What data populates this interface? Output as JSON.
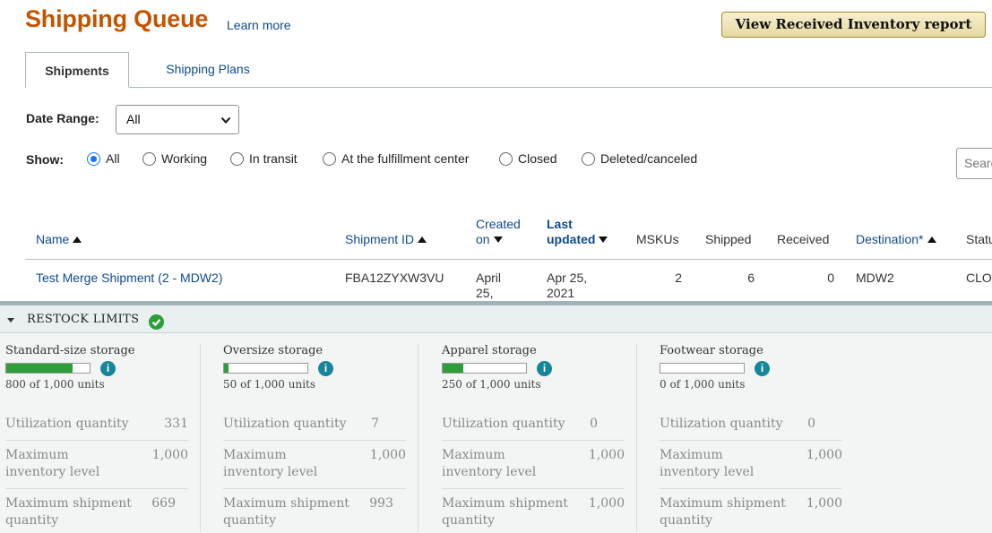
{
  "header": {
    "title": "Shipping Queue",
    "learn_more": "Learn more",
    "report_button": "View Received Inventory report"
  },
  "tabs": [
    {
      "label": "Shipments",
      "active": true
    },
    {
      "label": "Shipping Plans",
      "active": false
    }
  ],
  "filters": {
    "date_range_label": "Date Range:",
    "date_range_value": "All",
    "show_label": "Show:",
    "show_options": [
      {
        "label": "All",
        "checked": true
      },
      {
        "label": "Working",
        "checked": false
      },
      {
        "label": "In transit",
        "checked": false
      },
      {
        "label": "At the fulfillment center",
        "checked": false
      },
      {
        "label": "Closed",
        "checked": false
      },
      {
        "label": "Deleted/canceled",
        "checked": false
      }
    ],
    "search_placeholder": "Search"
  },
  "table": {
    "columns": {
      "name": "Name",
      "shipment_id": "Shipment ID",
      "created_on_1": "Created",
      "created_on_2": "on",
      "last_updated_1": "Last",
      "last_updated_2": "updated",
      "mskus": "MSKUs",
      "shipped": "Shipped",
      "received": "Received",
      "destination": "Destination*",
      "status": "Status"
    },
    "rows": [
      {
        "name": "Test Merge Shipment (2 - MDW2)",
        "shipment_id": "FBA12ZYXW3VU",
        "created_on_1": "April",
        "created_on_2": "25,",
        "last_updated_1": "Apr 25,",
        "last_updated_2": "2021",
        "mskus": "2",
        "shipped": "6",
        "received": "0",
        "destination": "MDW2",
        "status": "CLOSED"
      }
    ]
  },
  "restock": {
    "title": "RESTOCK LIMITS",
    "status_color": "#2e9e3a",
    "categories": [
      {
        "name": "Standard-size storage",
        "fill": 0.8,
        "units": "800 of 1,000 units",
        "metrics": [
          {
            "label": "Utilization quantity",
            "value": "331"
          },
          {
            "label": "Maximum inventory level",
            "value": "1,000"
          },
          {
            "label": "Maximum shipment quantity",
            "value": "669"
          }
        ]
      },
      {
        "name": "Oversize storage",
        "fill": 0.05,
        "units": "50 of 1,000 units",
        "metrics": [
          {
            "label": "Utilization quantity",
            "value": "7"
          },
          {
            "label": "Maximum inventory level",
            "value": "1,000"
          },
          {
            "label": "Maximum shipment quantity",
            "value": "993"
          }
        ]
      },
      {
        "name": "Apparel storage",
        "fill": 0.25,
        "units": "250 of 1,000 units",
        "metrics": [
          {
            "label": "Utilization quantity",
            "value": "0"
          },
          {
            "label": "Maximum inventory level",
            "value": "1,000"
          },
          {
            "label": "Maximum shipment quantity",
            "value": "1,000"
          }
        ]
      },
      {
        "name": "Footwear storage",
        "fill": 0,
        "units": "0 of 1,000 units",
        "metrics": [
          {
            "label": "Utilization quantity",
            "value": "0"
          },
          {
            "label": "Maximum inventory level",
            "value": "1,000"
          },
          {
            "label": "Maximum shipment quantity",
            "value": "1,000"
          }
        ]
      }
    ]
  }
}
